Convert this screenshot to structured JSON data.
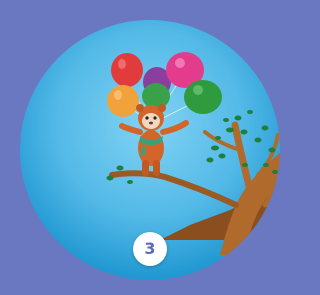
{
  "colors": {
    "background": "#6a78c2",
    "sky_light": "#6fc7ec",
    "sky_dark": "#1f9bd3",
    "badge_bg": "#ffffff",
    "badge_text": "#5a6bc0",
    "balloon_red": "#e23b3b",
    "balloon_pink": "#e33c8c",
    "balloon_orange": "#f2a23a",
    "balloon_green": "#2f9a3e",
    "balloon_purple": "#8a3fa0",
    "branch": "#a9652a",
    "leaves": "#1f7f3c"
  },
  "illustration": {
    "subject": "bear-character-floating-with-balloons",
    "icons": [
      "balloon-icon",
      "bear-character-icon",
      "tree-branch-icon"
    ]
  },
  "badge": {
    "label": "3"
  }
}
